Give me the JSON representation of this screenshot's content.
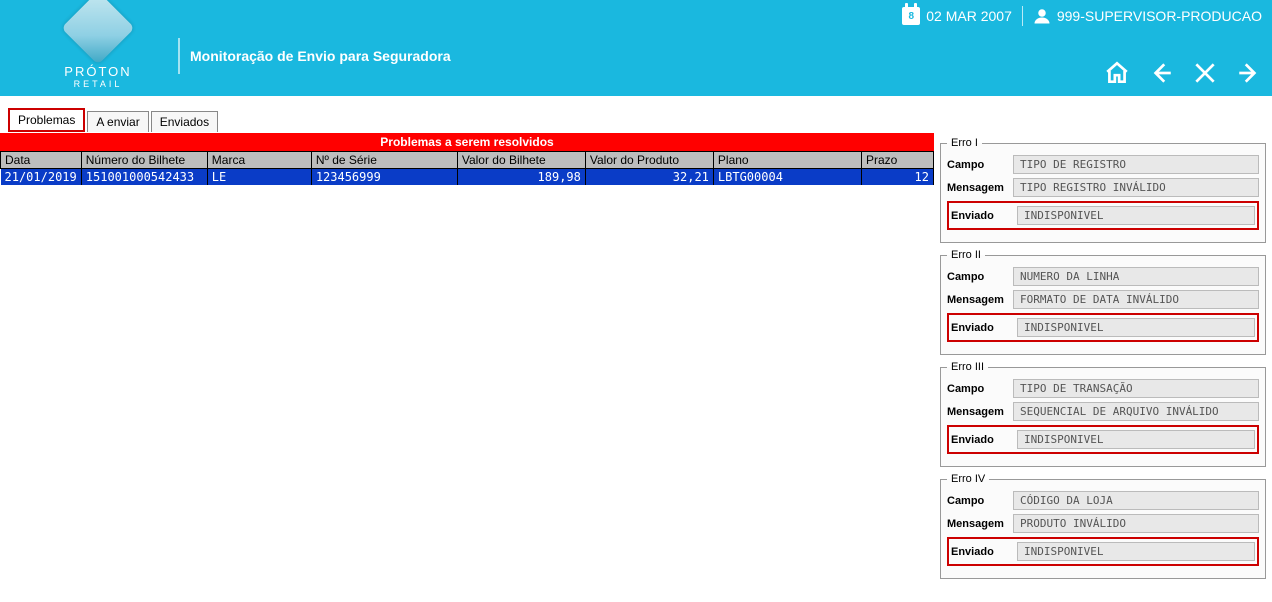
{
  "header": {
    "brand_top": "PRÓTON",
    "brand_sub": "RETAIL",
    "title": "Monitoração de Envio para Seguradora",
    "calendar_day": "8",
    "date": "02 MAR 2007",
    "user": "999-SUPERVISOR-PRODUCAO"
  },
  "tabs": {
    "problemas": "Problemas",
    "a_enviar": "A enviar",
    "enviados": "Enviados"
  },
  "banner": "Problemas a serem resolvidos",
  "columns": {
    "data": "Data",
    "numero": "Número do Bilhete",
    "marca": "Marca",
    "serie": "Nº de Série",
    "valor_bilhete": "Valor do Bilhete",
    "valor_produto": "Valor do Produto",
    "plano": "Plano",
    "prazo": "Prazo"
  },
  "row": {
    "data": "21/01/2019",
    "numero": "151001000542433",
    "marca": "LE",
    "serie": "123456999",
    "valor_bilhete": "189,98",
    "valor_produto": "32,21",
    "plano": "LBTG00004",
    "prazo": "12"
  },
  "labels": {
    "campo": "Campo",
    "mensagem": "Mensagem",
    "enviado": "Enviado"
  },
  "errors": [
    {
      "legend": "Erro I",
      "campo": "TIPO DE REGISTRO",
      "mensagem": "TIPO REGISTRO INVÁLIDO",
      "enviado": "INDISPONIVEL"
    },
    {
      "legend": "Erro II",
      "campo": "NUMERO DA LINHA",
      "mensagem": "FORMATO DE DATA INVÁLIDO",
      "enviado": "INDISPONIVEL"
    },
    {
      "legend": "Erro III",
      "campo": "TIPO DE TRANSAÇÃO",
      "mensagem": "SEQUENCIAL DE ARQUIVO INVÁLIDO",
      "enviado": "INDISPONIVEL"
    },
    {
      "legend": "Erro IV",
      "campo": "CÓDIGO DA LOJA",
      "mensagem": "PRODUTO INVÁLIDO",
      "enviado": "INDISPONIVEL"
    }
  ]
}
